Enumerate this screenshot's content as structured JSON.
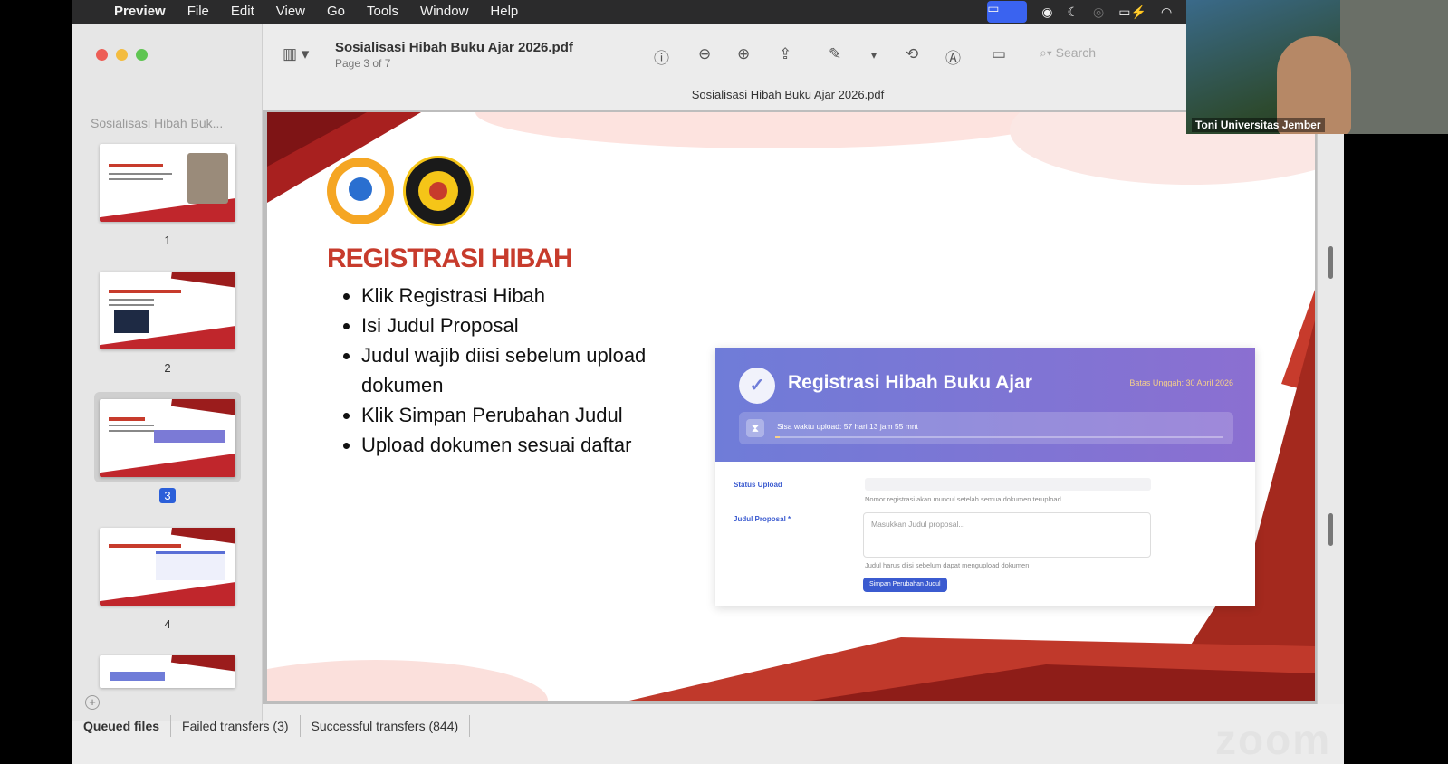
{
  "menubar": {
    "app": "Preview",
    "items": [
      "File",
      "Edit",
      "View",
      "Go",
      "Tools",
      "Window",
      "Help"
    ]
  },
  "sidebar": {
    "title": "Sosialisasi Hibah Buk...",
    "pages": [
      "1",
      "2",
      "3",
      "4"
    ],
    "selected_page": "3"
  },
  "toolbar": {
    "doc_title": "Sosialisasi Hibah Buku Ajar 2026.pdf",
    "page_status": "Page 3 of 7",
    "search_placeholder": "Search",
    "window_title": "Sosialisasi Hibah Buku Ajar 2026.pdf"
  },
  "slide": {
    "logo_left": "DIKTISAINTEK BERDAMPAK",
    "logo_right": "UNIVERSITAS JEMBER",
    "heading": "REGISTRASI HIBAH",
    "bullets": [
      "Klik Registrasi Hibah",
      "Isi Judul Proposal",
      "Judul wajib diisi sebelum upload dokumen",
      "Klik Simpan Perubahan Judul",
      "Upload dokumen sesuai daftar"
    ],
    "form": {
      "title": "Registrasi Hibah Buku Ajar",
      "deadline": "Batas Unggah: 30 April 2026",
      "timer": "Sisa waktu upload: 57 hari 13 jam 55 mnt",
      "status_label": "Status Upload",
      "status_hint": "Nomor registrasi akan muncul setelah semua dokumen terupload",
      "proposal_label": "Judul Proposal *",
      "proposal_placeholder": "Masukkan Judul proposal...",
      "proposal_hint": "Judul harus diisi sebelum dapat mengupload dokumen",
      "save_button": "Simpan Perubahan Judul"
    }
  },
  "transfer_tabs": [
    "Queued files",
    "Failed transfers (3)",
    "Successful transfers (844)"
  ],
  "video": {
    "participant": "Toni Universitas Jember"
  },
  "zoom_logo": "zoom"
}
